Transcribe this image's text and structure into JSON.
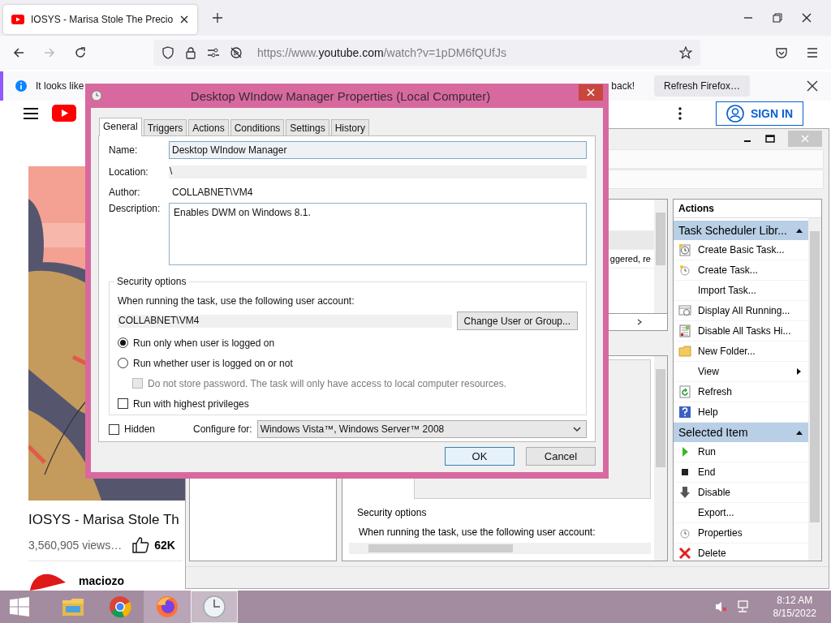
{
  "browser": {
    "tab": {
      "title": "IOSYS - Marisa Stole The Precio"
    },
    "url": {
      "prefix": "https://www.",
      "host": "youtube.com",
      "path": "/watch?v=1pDM6fQUfJs"
    },
    "notification": {
      "text_start": "It looks like",
      "text_end": "back!",
      "button": "Refresh Firefox…"
    }
  },
  "youtube": {
    "sign_in": "SIGN IN",
    "video_title": "IOSYS - Marisa Stole Th",
    "views": "3,560,905 views…",
    "likes": "62K",
    "channel": "maciozo"
  },
  "task_scheduler": {
    "middle_text": "ggered, re",
    "security_label": "Security options",
    "account_prompt": "When running the task, use the following user account:",
    "actions_header": "Actions",
    "sections": [
      {
        "title": "Task Scheduler Libr...",
        "expanded": true,
        "items": [
          {
            "label": "Create Basic Task...",
            "kind": "basic-task"
          },
          {
            "label": "Create Task...",
            "kind": "create-task"
          },
          {
            "label": "Import Task...",
            "kind": "none"
          },
          {
            "label": "Display All Running...",
            "kind": "running"
          },
          {
            "label": "Disable All Tasks Hi...",
            "kind": "history"
          },
          {
            "label": "New Folder...",
            "kind": "folder"
          },
          {
            "label": "View",
            "kind": "none",
            "submenu": true
          },
          {
            "label": "Refresh",
            "kind": "refresh"
          },
          {
            "label": "Help",
            "kind": "help"
          }
        ]
      },
      {
        "title": "Selected Item",
        "expanded": true,
        "items": [
          {
            "label": "Run",
            "kind": "run"
          },
          {
            "label": "End",
            "kind": "end"
          },
          {
            "label": "Disable",
            "kind": "disable"
          },
          {
            "label": "Export...",
            "kind": "none"
          },
          {
            "label": "Properties",
            "kind": "properties"
          },
          {
            "label": "Delete",
            "kind": "delete"
          }
        ]
      }
    ]
  },
  "dialog": {
    "title": "Desktop WIndow Manager Properties (Local Computer)",
    "tabs": [
      {
        "label": "General",
        "selected": true
      },
      {
        "label": "Triggers",
        "selected": false
      },
      {
        "label": "Actions",
        "selected": false
      },
      {
        "label": "Conditions",
        "selected": false
      },
      {
        "label": "Settings",
        "selected": false
      },
      {
        "label": "History",
        "selected": false
      }
    ],
    "name_label": "Name:",
    "name": "Desktop WIndow Manager",
    "location_label": "Location:",
    "location": "\\",
    "author_label": "Author:",
    "author": "COLLABNET\\VM4",
    "description_label": "Description:",
    "description": "Enables DWM on Windows 8.1.",
    "security": {
      "legend": "Security options",
      "prompt": "When running the task, use the following user account:",
      "account": "COLLABNET\\VM4",
      "change_button": "Change User or Group...",
      "radios": [
        {
          "label": "Run only when user is logged on",
          "selected": true
        },
        {
          "label": "Run whether user is logged on or not",
          "selected": false
        }
      ],
      "do_not_store": {
        "label": "Do not store password.  The task will only have access to local computer resources.",
        "checked": false,
        "disabled": true
      },
      "highest": {
        "label": "Run with highest privileges",
        "checked": false
      }
    },
    "hidden": {
      "label": "Hidden",
      "checked": false
    },
    "configure_label": "Configure for:",
    "configure_value": "Windows Vista™, Windows Server™ 2008",
    "buttons": [
      {
        "label": "OK",
        "default": true
      },
      {
        "label": "Cancel",
        "default": false
      }
    ]
  },
  "taskbar": {
    "apps": [
      {
        "kind": "explorer",
        "open": false,
        "selected": false
      },
      {
        "kind": "chrome",
        "open": false,
        "selected": false
      },
      {
        "kind": "firefox",
        "open": true,
        "selected": false
      },
      {
        "kind": "clock",
        "open": true,
        "selected": true
      }
    ],
    "time": "8:12 AM",
    "date": "8/15/2022"
  }
}
